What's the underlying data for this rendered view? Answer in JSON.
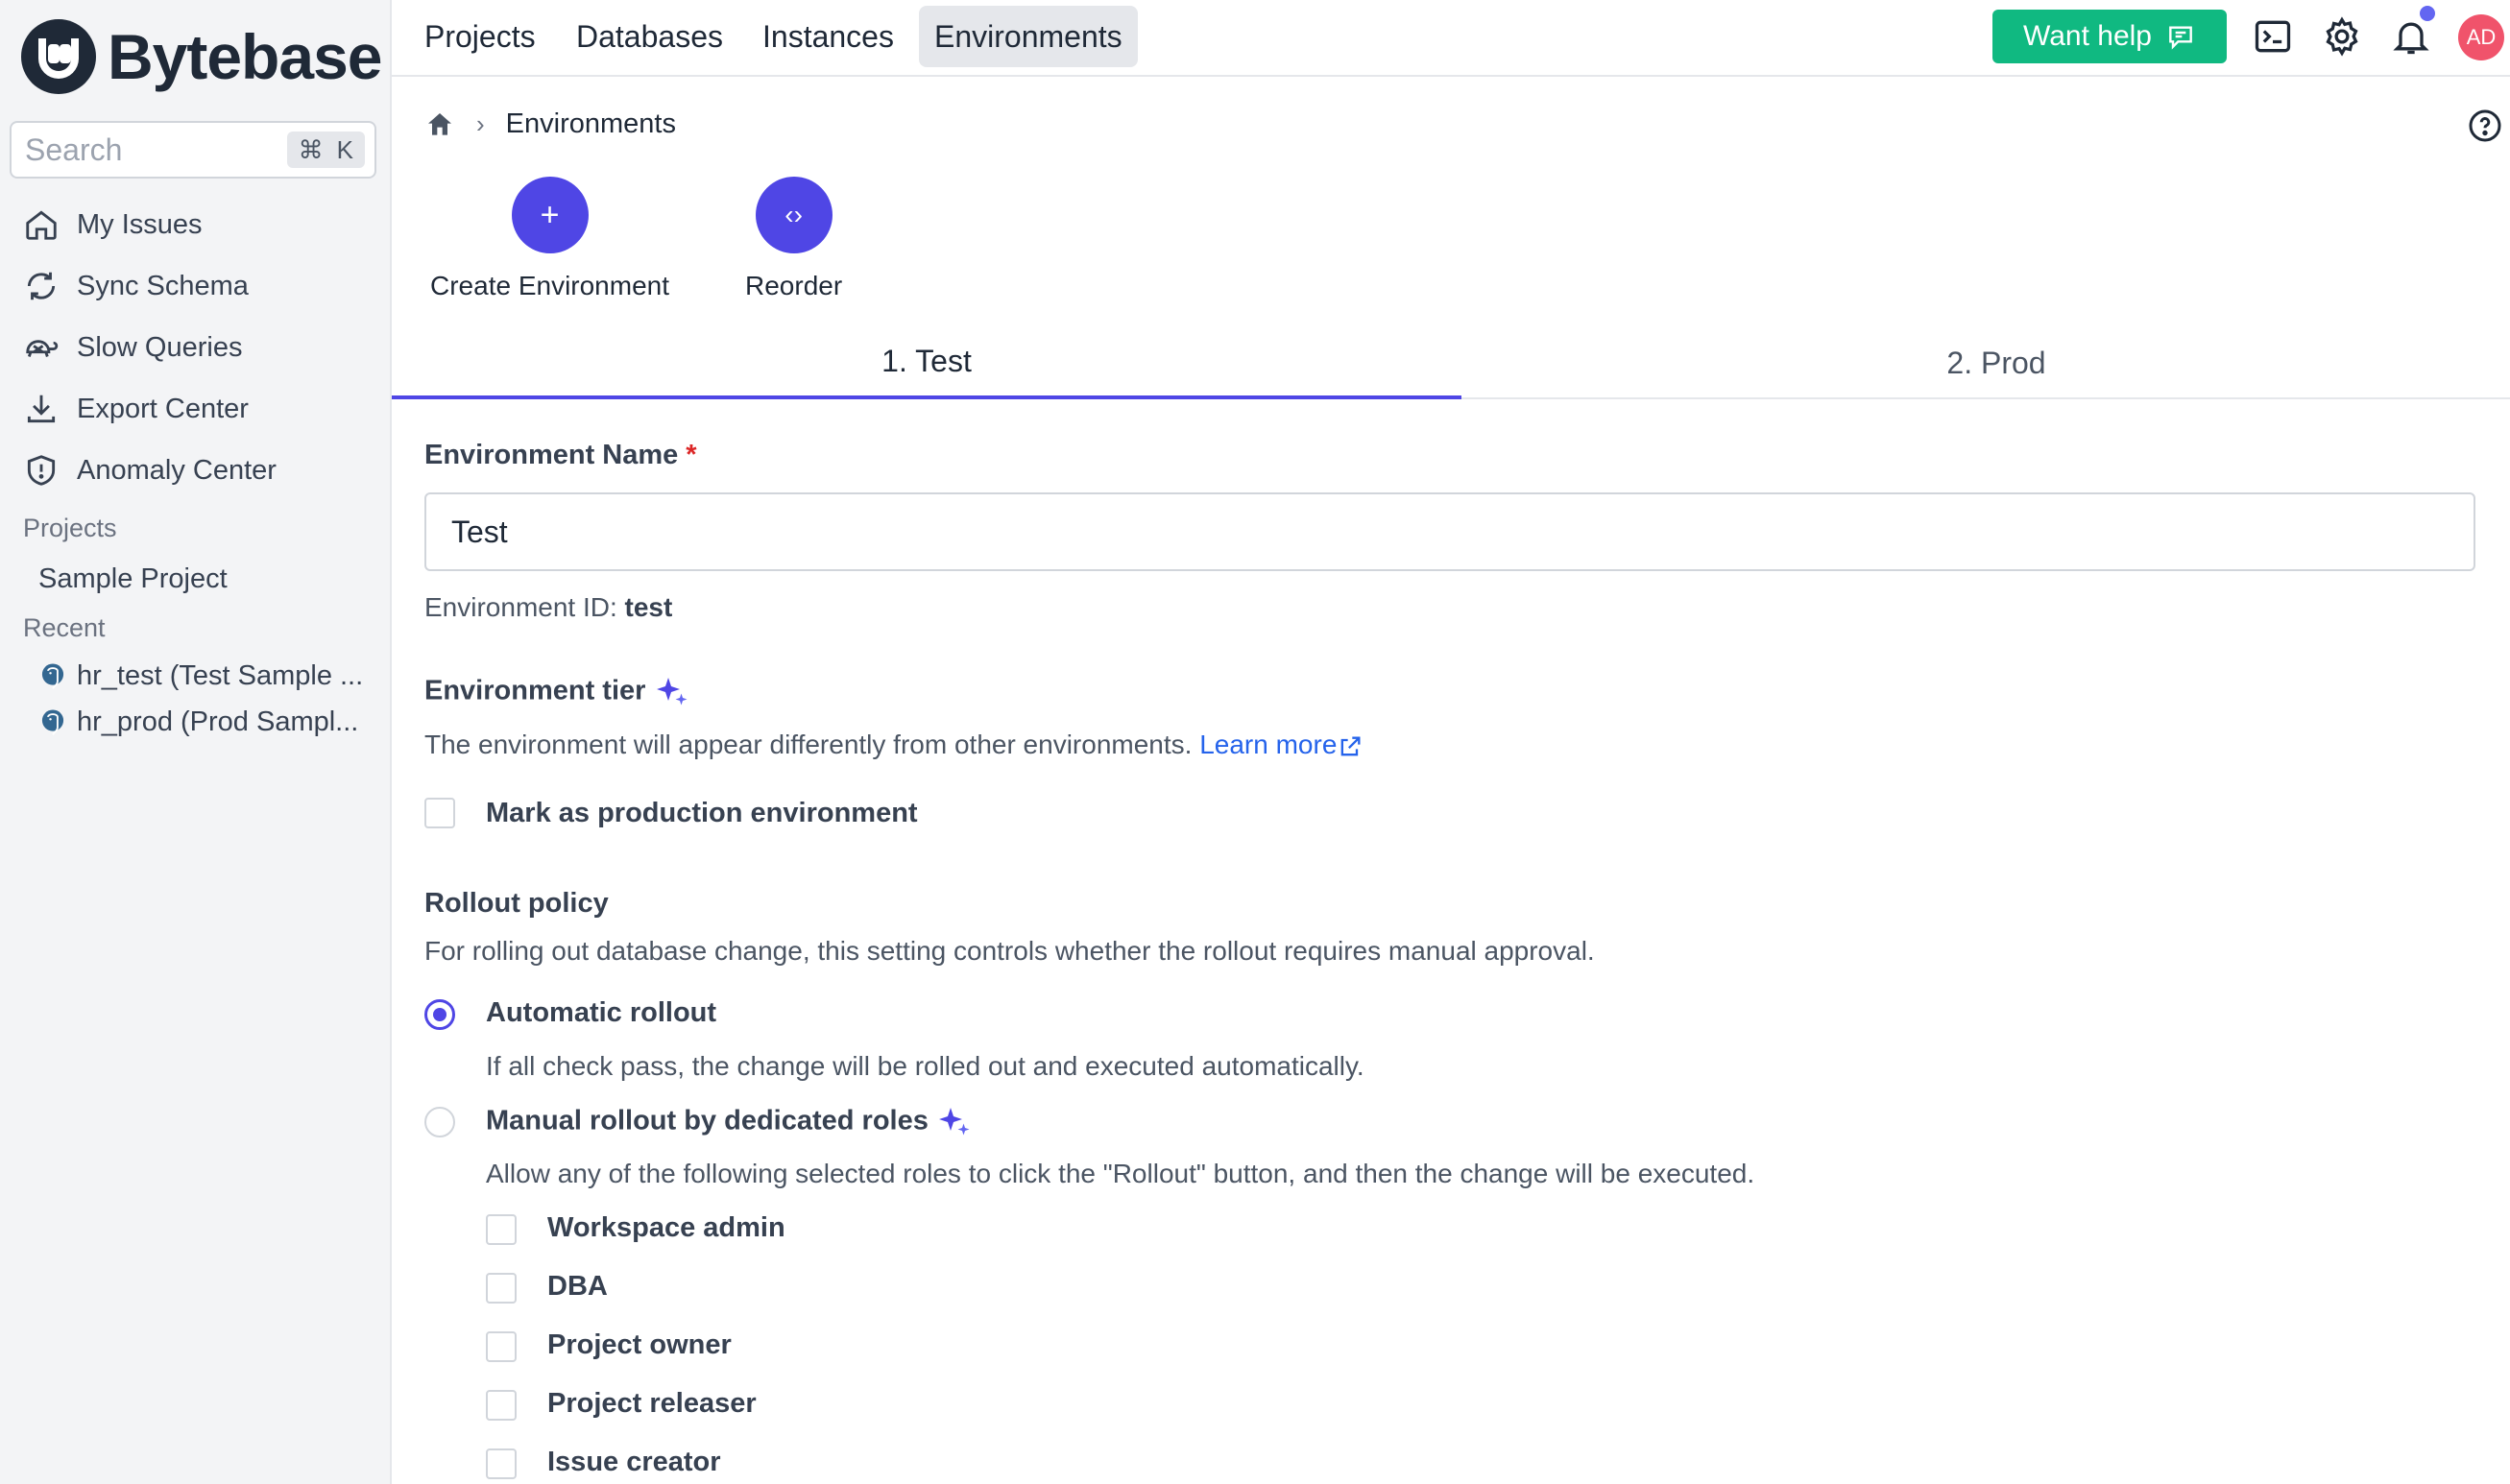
{
  "brand": {
    "name": "Bytebase"
  },
  "search": {
    "placeholder": "Search",
    "shortcut_symbol": "⌘",
    "shortcut_key": "K"
  },
  "sidebar": {
    "items": [
      {
        "label": "My Issues",
        "icon": "home-icon"
      },
      {
        "label": "Sync Schema",
        "icon": "sync-icon"
      },
      {
        "label": "Slow Queries",
        "icon": "turtle-icon"
      },
      {
        "label": "Export Center",
        "icon": "download-icon"
      },
      {
        "label": "Anomaly Center",
        "icon": "shield-icon"
      }
    ],
    "projects_label": "Projects",
    "projects": [
      {
        "label": "Sample Project"
      }
    ],
    "recent_label": "Recent",
    "recent": [
      {
        "label": "hr_test (Test Sample ...",
        "icon": "postgres-icon"
      },
      {
        "label": "hr_prod (Prod Sampl...",
        "icon": "postgres-icon"
      }
    ]
  },
  "topnav": {
    "items": [
      {
        "label": "Projects"
      },
      {
        "label": "Databases"
      },
      {
        "label": "Instances"
      },
      {
        "label": "Environments",
        "active": true
      }
    ],
    "help_label": "Want help",
    "avatar_initials": "AD"
  },
  "breadcrumb": {
    "current": "Environments"
  },
  "actions": {
    "create_label": "Create Environment",
    "create_glyph": "+",
    "reorder_label": "Reorder",
    "reorder_glyph": "‹›"
  },
  "tabs": [
    {
      "label": "1. Test",
      "active": true
    },
    {
      "label": "2. Prod"
    }
  ],
  "form": {
    "name_label": "Environment Name",
    "required_mark": "*",
    "name_value": "Test",
    "id_prefix": "Environment ID:",
    "id_value": "test",
    "tier_label": "Environment tier",
    "tier_desc": "The environment will appear differently from other environments.",
    "learn_more": "Learn more",
    "production_label": "Mark as production environment",
    "rollout_label": "Rollout policy",
    "rollout_desc": "For rolling out database change, this setting controls whether the rollout requires manual approval.",
    "auto_label": "Automatic rollout",
    "auto_desc": "If all check pass, the change will be rolled out and executed automatically.",
    "manual_label": "Manual rollout by dedicated roles",
    "manual_desc": "Allow any of the following selected roles to click the \"Rollout\" button, and then the change will be executed.",
    "roles": [
      {
        "label": "Workspace admin"
      },
      {
        "label": "DBA"
      },
      {
        "label": "Project owner"
      },
      {
        "label": "Project releaser"
      },
      {
        "label": "Issue creator"
      }
    ]
  },
  "colors": {
    "accent": "#4f46e5",
    "help": "#10b981",
    "avatar": "#f0536b",
    "link": "#2563eb",
    "required": "#dc2626"
  }
}
